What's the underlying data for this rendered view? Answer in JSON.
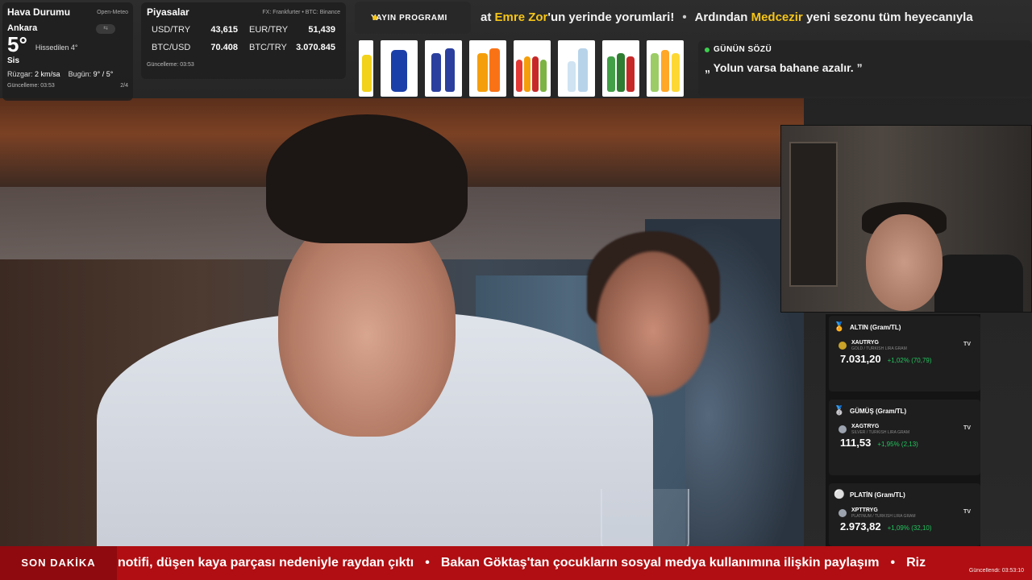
{
  "weather": {
    "title": "Hava Durumu",
    "source": "Open-Meteo",
    "city": "Ankara",
    "toggle": "⇆",
    "temp": "5°",
    "feels": "Hissedilen 4°",
    "condition": "Sis",
    "wind_label": "Rüzgar:",
    "wind_value": "2 km/sa",
    "today_label": "Bugün:",
    "today_value": "9° / 5°",
    "updated": "Güncelleme: 03:53",
    "page": "2/4"
  },
  "markets": {
    "title": "Piyasalar",
    "source": "FX: Frankfurter • BTC: Binance",
    "rows": [
      {
        "k": "USD/TRY",
        "v": "43,615"
      },
      {
        "k": "EUR/TRY",
        "v": "51,439"
      },
      {
        "k": "BTC/USD",
        "v": "70.408"
      },
      {
        "k": "BTC/TRY",
        "v": "3.070.845"
      }
    ],
    "updated": "Güncelleme: 03:53"
  },
  "schedule": {
    "label": "YAYIN PROGRAMI",
    "part1": "at ",
    "hl1": "Emre Zor",
    "part2": "'un yerinde yorumlari!",
    "sep": "•",
    "part3": "Ardından ",
    "hl2": "Medcezir",
    "part4": " yeni sezonu tüm heyecanıyla"
  },
  "quote": {
    "label": "GÜNÜN SÖZÜ",
    "text": "„ Yolun varsa bahane azalır. ”"
  },
  "commodities": [
    {
      "icon": "🏅",
      "title": "ALTIN (Gram/TL)",
      "symbol": "XAUTRYG",
      "sub": "GOLD / TURKISH LIRA GRAM",
      "price": "7.031,20",
      "change": "+1,02% (70,79)",
      "coin_color": "#c9a227"
    },
    {
      "icon": "🥈",
      "title": "GÜMÜŞ (Gram/TL)",
      "symbol": "XAGTRYG",
      "sub": "SILVER / TURKISH LIRA GRAM",
      "price": "111,53",
      "change": "+1,95% (2,13)",
      "coin_color": "#9ca3af"
    },
    {
      "icon": "⚪",
      "title": "PLATİN (Gram/TL)",
      "symbol": "XPTTRYG",
      "sub": "PLATINUM / TURKISH LIRA GRAM",
      "price": "2.973,82",
      "change": "+1,09% (32,10)",
      "coin_color": "#9ca3af"
    }
  ],
  "tv_logo": "TV",
  "news": {
    "label": "SON DAKİKA",
    "item1": "notifi, düşen kaya parçası nedeniyle raydan çıktı",
    "sep": "•",
    "item2": "Bakan Göktaş'tan çocukların sosyal medya kullanımına ilişkin paylaşım",
    "item3": "Riz",
    "updated": "Güncellendi: 03:53:10"
  },
  "colors": {
    "accent_yellow": "#f5c518",
    "news_red": "#b00e12",
    "up_green": "#22c55e"
  }
}
